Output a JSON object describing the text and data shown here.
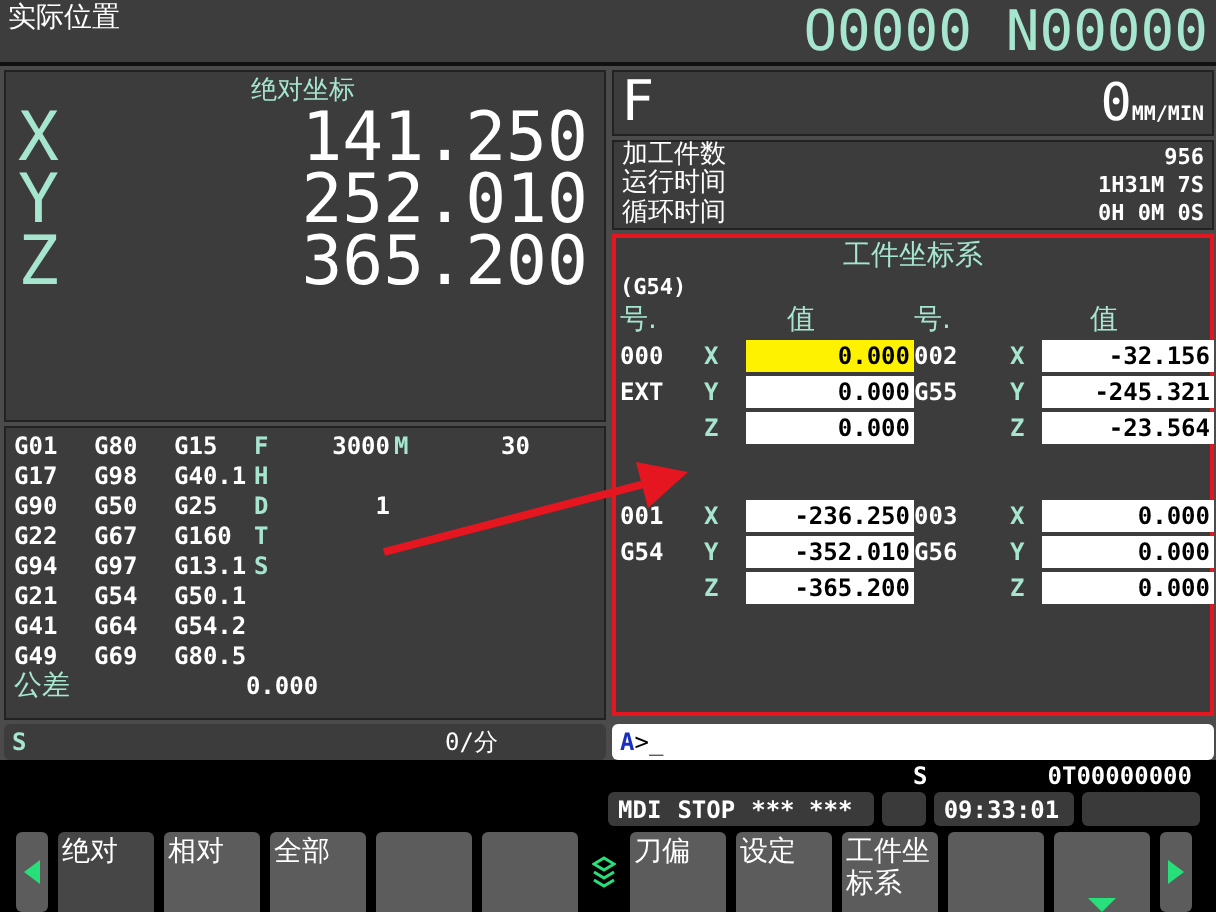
{
  "header": {
    "title": "实际位置",
    "program": "O0000 N00000"
  },
  "position": {
    "title": "绝对坐标",
    "axes": [
      {
        "axis": "X",
        "value": "141.250"
      },
      {
        "axis": "Y",
        "value": "252.010"
      },
      {
        "axis": "Z",
        "value": "365.200"
      }
    ]
  },
  "modal": {
    "rows": [
      {
        "codes": [
          "G01",
          "G80",
          "G15"
        ],
        "letter": "F",
        "value": "3000",
        "letter2": "M",
        "value2": "30"
      },
      {
        "codes": [
          "G17",
          "G98",
          "G40.1"
        ],
        "letter": "H"
      },
      {
        "codes": [
          "G90",
          "G50",
          "G25"
        ],
        "letter": "D",
        "value": "1"
      },
      {
        "codes": [
          "G22",
          "G67",
          "G160"
        ],
        "letter": "T"
      },
      {
        "codes": [
          "G94",
          "G97",
          "G13.1"
        ],
        "letter": "S"
      },
      {
        "codes": [
          "G21",
          "G54",
          "G50.1"
        ]
      },
      {
        "codes": [
          "G41",
          "G64",
          "G54.2"
        ]
      },
      {
        "codes": [
          "G49",
          "G69",
          "G80.5"
        ]
      }
    ],
    "tolerance": {
      "label": "公差",
      "value": "0.000"
    }
  },
  "spindle": {
    "label": "S",
    "value": "0/分"
  },
  "feed": {
    "label": "F",
    "value": "0",
    "unit": "MM/MIN"
  },
  "counters": [
    {
      "label": "加工件数",
      "value": "956"
    },
    {
      "label": "运行时间",
      "value": "1H31M 7S"
    },
    {
      "label": "循环时间",
      "value": "0H 0M 0S"
    }
  ],
  "work_coords": {
    "title": "工件坐标系",
    "highlighted": true,
    "current": "(G54)",
    "headers": [
      "号.",
      "值",
      "号.",
      "值"
    ],
    "groups": [
      {
        "number": "000",
        "name": "EXT",
        "values": [
          {
            "axis": "X",
            "value": "0.000",
            "selected": true
          },
          {
            "axis": "Y",
            "value": "0.000",
            "selected": false
          },
          {
            "axis": "Z",
            "value": "0.000",
            "selected": false
          }
        ]
      },
      {
        "number": "002",
        "name": "G55",
        "values": [
          {
            "axis": "X",
            "value": "-32.156",
            "selected": false
          },
          {
            "axis": "Y",
            "value": "-245.321",
            "selected": false
          },
          {
            "axis": "Z",
            "value": "-23.564",
            "selected": false
          }
        ]
      },
      {
        "number": "001",
        "name": "G54",
        "values": [
          {
            "axis": "X",
            "value": "-236.250",
            "selected": false
          },
          {
            "axis": "Y",
            "value": "-352.010",
            "selected": false
          },
          {
            "axis": "Z",
            "value": "-365.200",
            "selected": false
          }
        ]
      },
      {
        "number": "003",
        "name": "G56",
        "values": [
          {
            "axis": "X",
            "value": "0.000",
            "selected": false
          },
          {
            "axis": "Y",
            "value": "0.000",
            "selected": false
          },
          {
            "axis": "Z",
            "value": "0.000",
            "selected": false
          }
        ]
      }
    ]
  },
  "input": {
    "prompt": "A",
    "text": ">_"
  },
  "status": {
    "spindle": "S",
    "tool": "0T00000000",
    "mode": "MDI",
    "state": "STOP",
    "alarm": "*** ***",
    "time": "09:33:01"
  },
  "annotation_arrow": true,
  "softkeys": [
    {
      "kind": "prev"
    },
    {
      "kind": "key",
      "label": "绝对",
      "selected": true
    },
    {
      "kind": "key",
      "label": "相对",
      "selected": false
    },
    {
      "kind": "key",
      "label": "全部",
      "selected": false
    },
    {
      "kind": "blank"
    },
    {
      "kind": "blank"
    },
    {
      "kind": "menu"
    },
    {
      "kind": "key",
      "label": "刀偏",
      "selected": false
    },
    {
      "kind": "key",
      "label": "设定",
      "selected": false
    },
    {
      "kind": "key",
      "label": "工件坐标系",
      "selected": false
    },
    {
      "kind": "blank"
    },
    {
      "kind": "more"
    },
    {
      "kind": "next"
    }
  ]
}
